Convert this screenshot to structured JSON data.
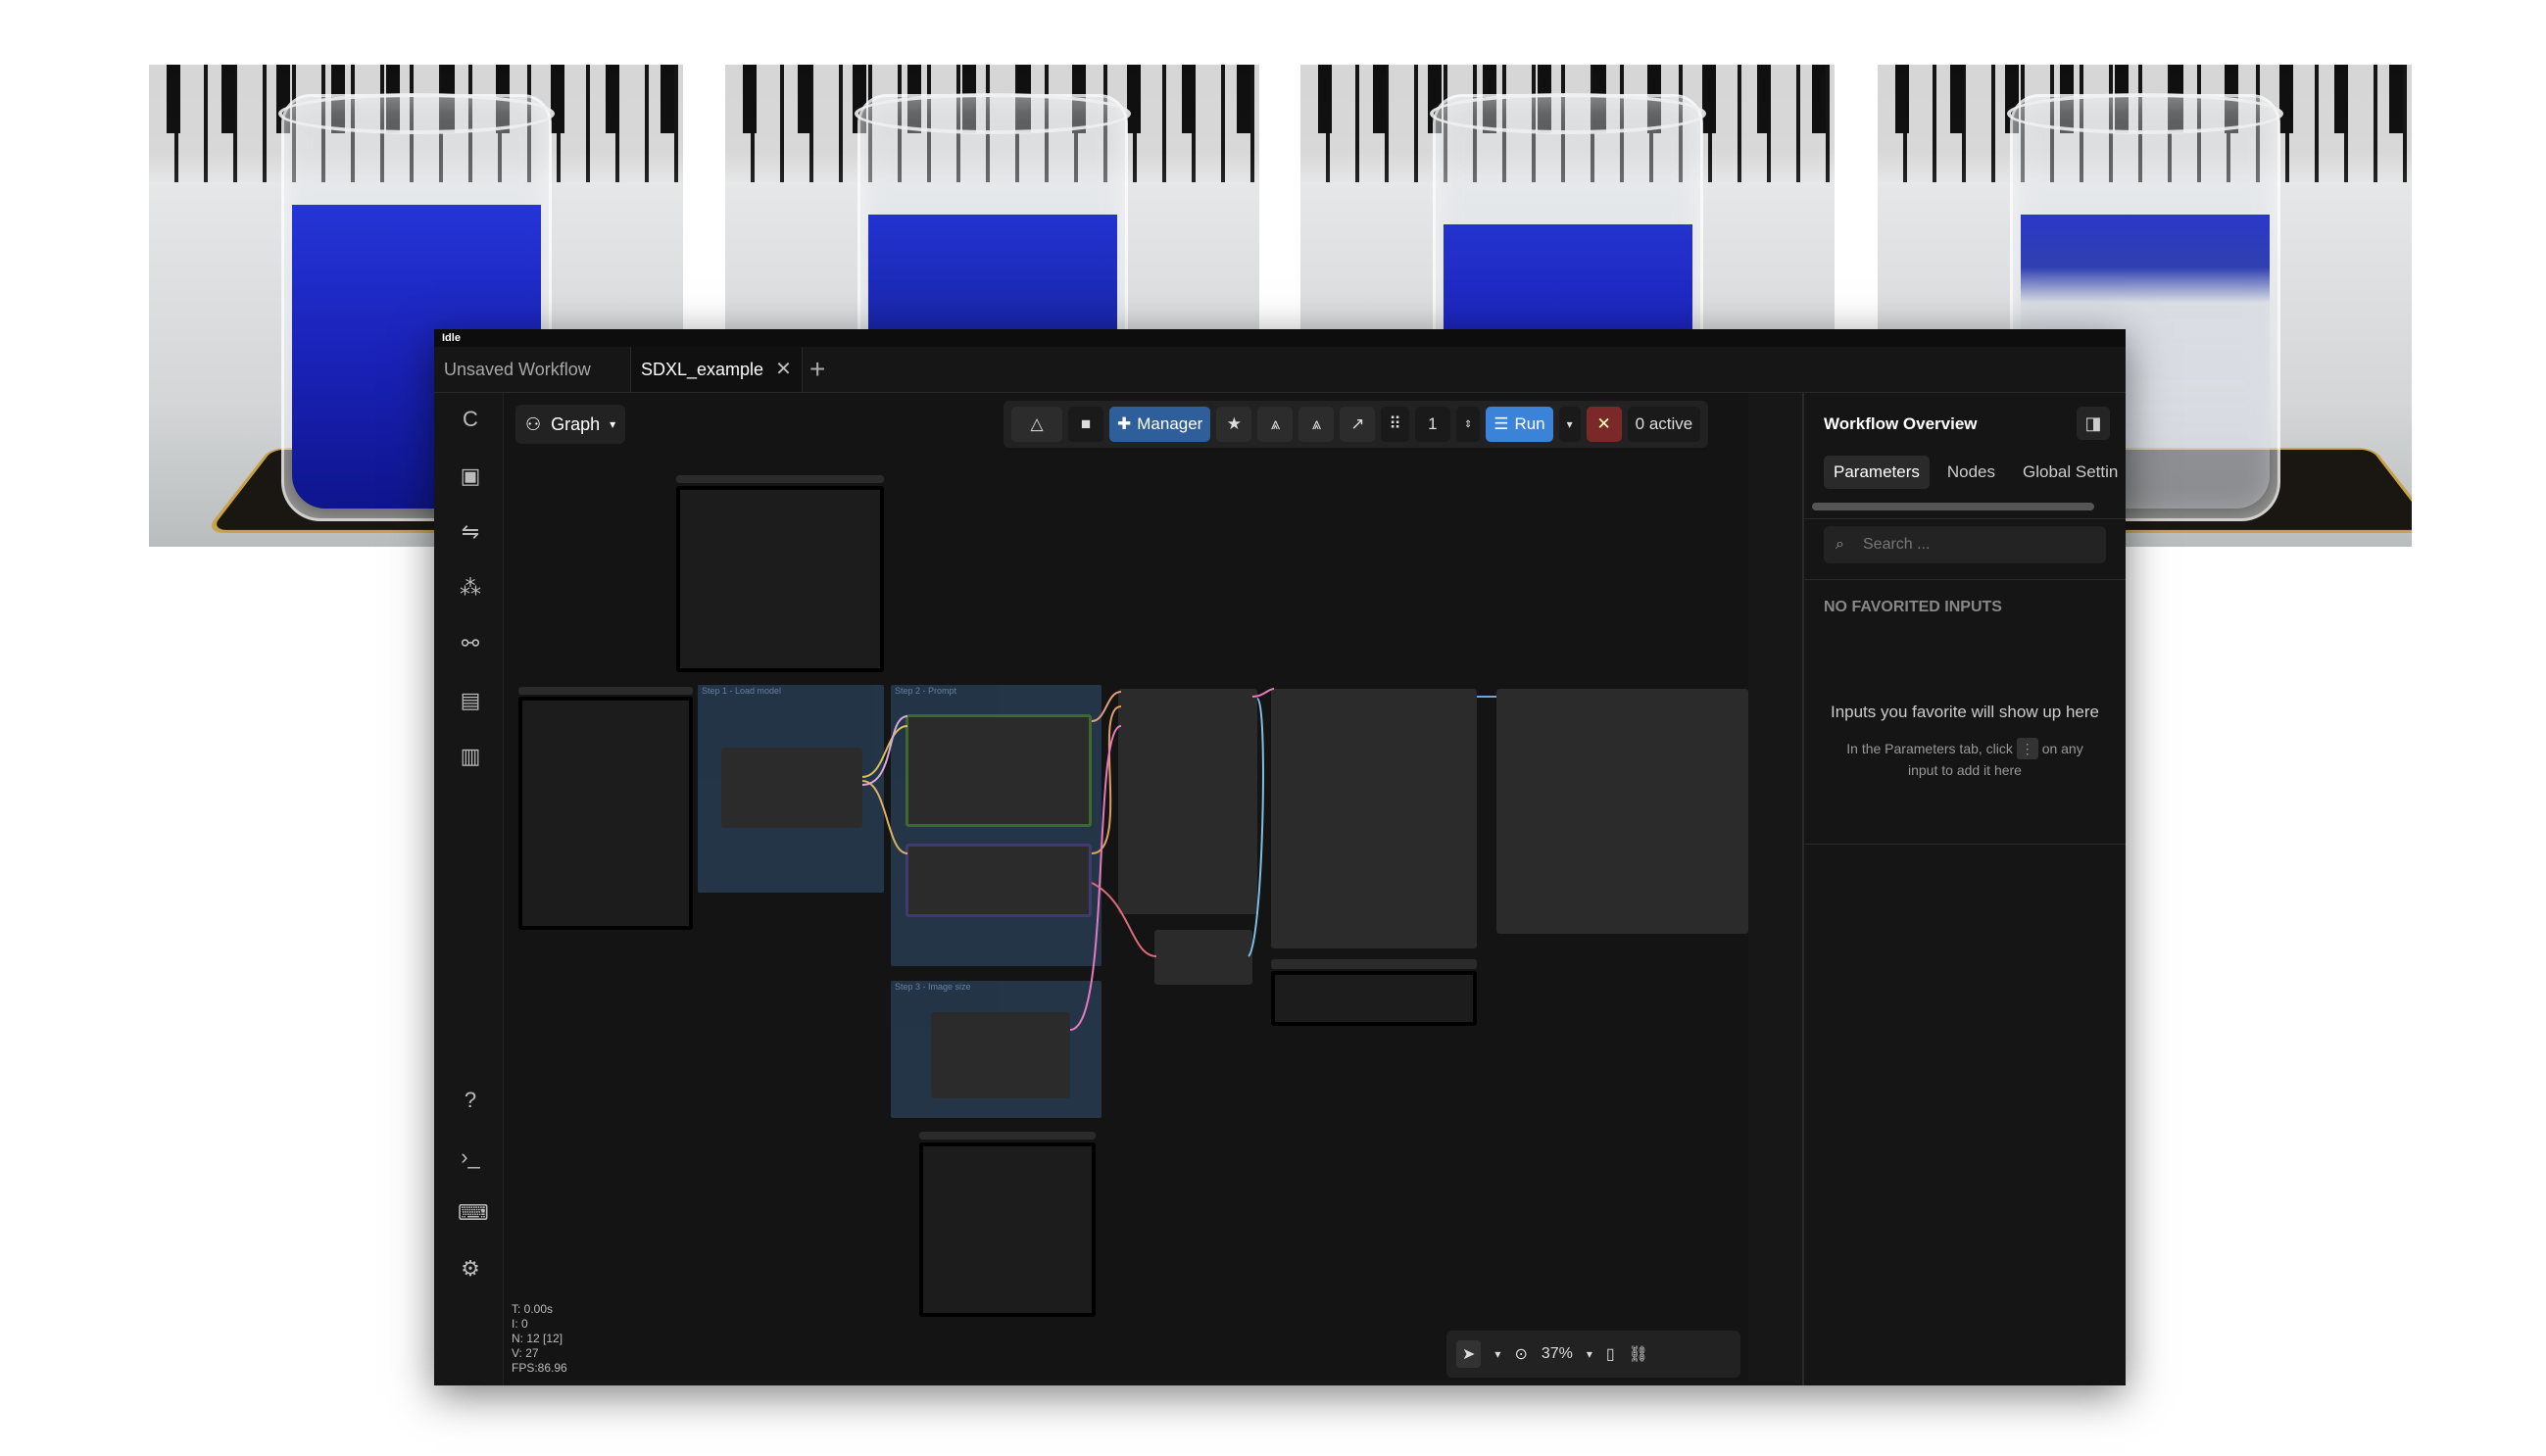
{
  "app": {
    "status": "Idle",
    "tabs": [
      {
        "label": "Unsaved Workflow",
        "active": false
      },
      {
        "label": "SDXL_example",
        "active": true
      }
    ]
  },
  "toolbar": {
    "view_label": "Graph",
    "manager_label": "Manager",
    "batch_count": "1",
    "run_label": "Run",
    "active_label": "0 active"
  },
  "canvas": {
    "groups": [
      "Step 1 - Load model",
      "Step 2 - Prompt",
      "Step 3 - Image size"
    ],
    "stats": [
      "T: 0.00s",
      "I: 0",
      "N: 12 [12]",
      "V: 27",
      "FPS:86.96"
    ],
    "zoom": "37%"
  },
  "panel": {
    "title": "Workflow Overview",
    "tabs": [
      "Parameters",
      "Nodes",
      "Global Settin"
    ],
    "search_placeholder": "Search ...",
    "no_favorites": "NO FAVORITED INPUTS",
    "empty_title": "Inputs you favorite will show up here",
    "empty_body_1": "In the Parameters tab, click",
    "empty_body_2": "on any input to add it here"
  },
  "colors": {
    "liquid": "#1a22b8",
    "accent": "#3a83d8",
    "manager": "#2f5f9a"
  }
}
